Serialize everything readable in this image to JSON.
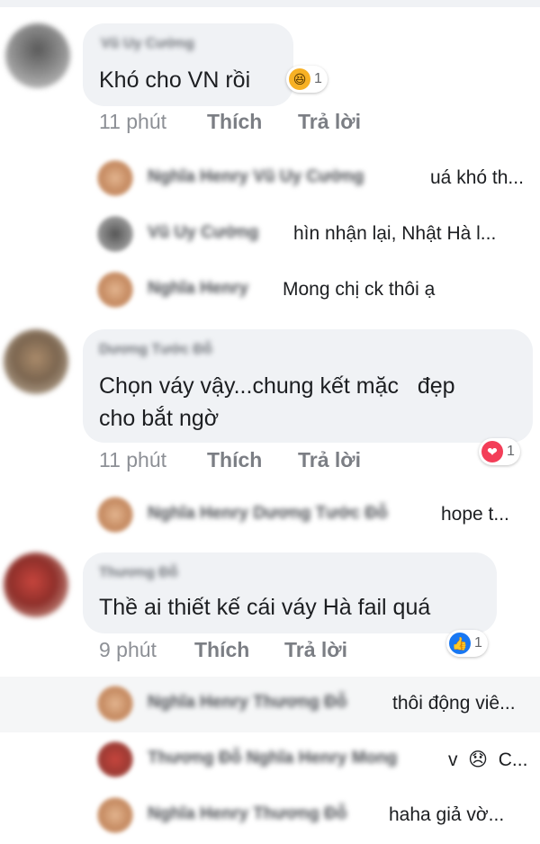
{
  "comments": [
    {
      "author": "Vũ Uy Cường",
      "text": "Khó cho VN rồi",
      "time": "11 phút",
      "like_label": "Thích",
      "reply_label": "Trả lời",
      "reaction": {
        "type": "haha",
        "count": "1"
      },
      "replies": [
        {
          "names": "Nghĩa Henry Vũ Uy Cường",
          "text": "uá khó th..."
        },
        {
          "names": "Vũ Uy Cường",
          "text": "hìn nhận lại, Nhật Hà l..."
        },
        {
          "names": "Nghĩa Henry",
          "text": "Mong chị ck thôi ạ"
        }
      ]
    },
    {
      "author": "Dương Tước Đỗ",
      "text_line1": "Chọn váy vậy...chung kết mặc   đẹp",
      "text_line2": "cho bắt ngờ",
      "time": "11 phút",
      "like_label": "Thích",
      "reply_label": "Trả lời",
      "reaction": {
        "type": "love",
        "count": "1"
      },
      "replies": [
        {
          "names": "Nghĩa Henry Dương Tước Đỗ",
          "text": "hope t..."
        }
      ]
    },
    {
      "author": "Thương Đỗ",
      "text": "Thề ai thiết kế cái váy Hà fail quá",
      "time": "9 phút",
      "like_label": "Thích",
      "reply_label": "Trả lời",
      "reaction": {
        "type": "like",
        "count": "1"
      },
      "replies": [
        {
          "names": "Nghĩa Henry Thương Đỗ",
          "text": "thôi động viê..."
        },
        {
          "names": "Thương Đỗ Nghĩa Henry Mong",
          "text": "v  😞  C..."
        },
        {
          "names": "Nghĩa Henry Thương Đỗ",
          "text": "haha giả vờ..."
        }
      ]
    }
  ],
  "colors": {
    "haha": "#f7b125",
    "love": "#f33e58",
    "like": "#1877f2"
  }
}
